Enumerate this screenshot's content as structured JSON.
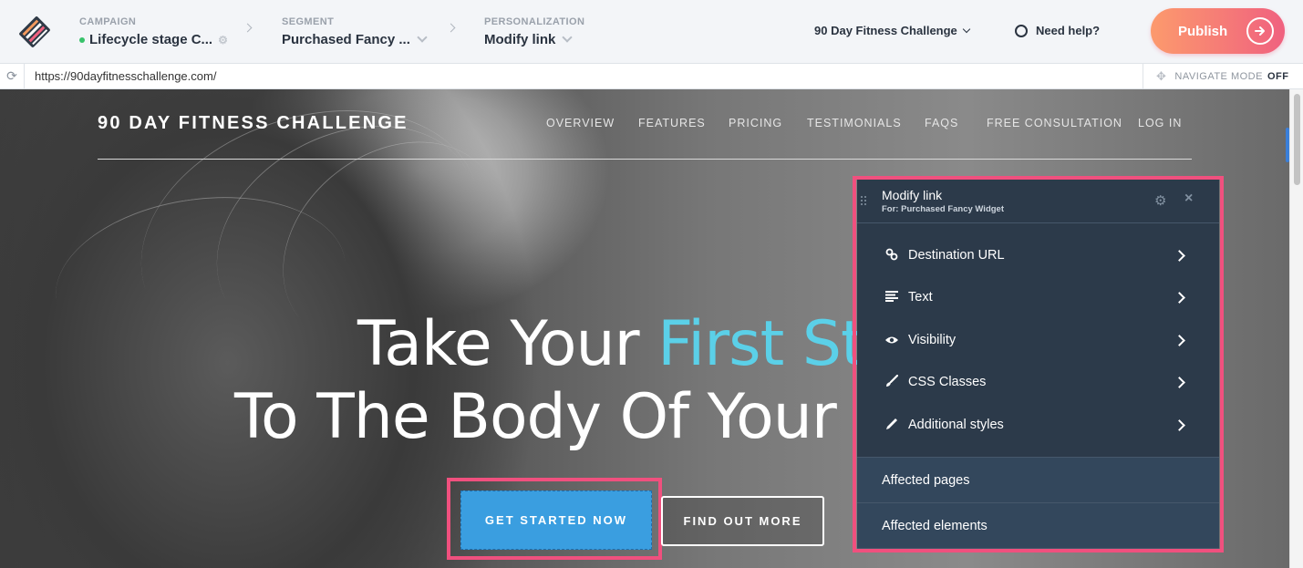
{
  "header": {
    "campaign": {
      "label": "CAMPAIGN",
      "value": "Lifecycle stage C...",
      "status_color": "#37c26a"
    },
    "segment": {
      "label": "SEGMENT",
      "value": "Purchased Fancy ..."
    },
    "personalization": {
      "label": "PERSONALIZATION",
      "value": "Modify link"
    },
    "page_select": "90 Day Fitness Challenge",
    "help": "Need help?",
    "publish": "Publish"
  },
  "urlbar": {
    "url": "https://90dayfitnesschallenge.com/",
    "navigate_mode_label": "NAVIGATE MODE",
    "navigate_mode_state": "OFF"
  },
  "site": {
    "logo": "90 DAY FITNESS CHALLENGE",
    "nav": [
      "OVERVIEW",
      "FEATURES",
      "PRICING",
      "TESTIMONIALS",
      "FAQS",
      "FREE CONSULTATION",
      "LOG IN"
    ],
    "hero": {
      "line1_a": "Take Your ",
      "line1_b": "First St",
      "line2": "To The Body Of Your D",
      "accent_color": "#5bd0e8"
    },
    "primary_button": "GET STARTED NOW",
    "secondary_button": "FIND OUT MORE"
  },
  "panel": {
    "title": "Modify link",
    "subtitle": "For: Purchased Fancy Widget",
    "items": [
      {
        "label": "Destination URL",
        "icon": "link-icon"
      },
      {
        "label": "Text",
        "icon": "text-align-icon"
      },
      {
        "label": "Visibility",
        "icon": "eye-icon"
      },
      {
        "label": "CSS Classes",
        "icon": "brush-icon"
      },
      {
        "label": "Additional styles",
        "icon": "pencil-icon"
      }
    ],
    "sections": [
      "Affected pages",
      "Affected elements"
    ]
  },
  "colors": {
    "brand_gradient_start": "#fc9a6d",
    "brand_gradient_end": "#f0617f",
    "highlight": "#f0507e",
    "panel_bg": "#2c3a4a",
    "selected_button": "#3a9ee0"
  }
}
